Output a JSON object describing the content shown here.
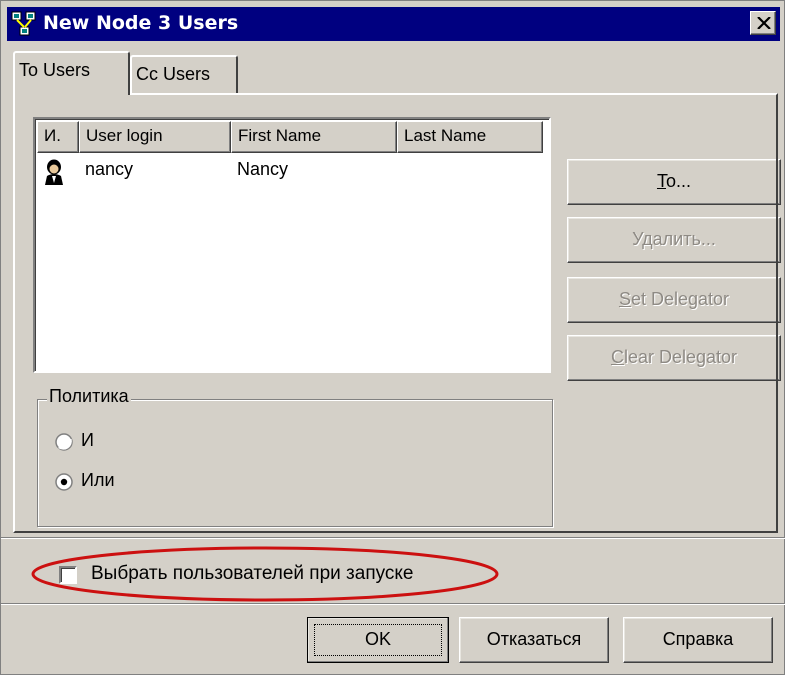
{
  "window": {
    "title": "New Node 3 Users",
    "icon": "network-nodes-icon",
    "close_icon": "close-icon"
  },
  "tabs": [
    {
      "label": "To Users",
      "active": true
    },
    {
      "label": "Cc Users",
      "active": false
    }
  ],
  "user_list": {
    "columns": [
      "И.",
      "User login",
      "First Name",
      "Last Name"
    ],
    "rows": [
      {
        "icon": "user-icon",
        "login": "nancy",
        "first_name": "Nancy",
        "last_name": ""
      }
    ]
  },
  "side_buttons": {
    "to": {
      "mnemonic": "T",
      "rest": "o...",
      "enabled": true
    },
    "delete": {
      "label": "Удалить...",
      "enabled": false
    },
    "set_delegator": {
      "mnemonic": "S",
      "rest": "et Delegator",
      "enabled": false
    },
    "clear_delegator": {
      "mnemonic": "C",
      "rest": "lear Delegator",
      "enabled": false
    }
  },
  "policy": {
    "title": "Политика",
    "options": [
      {
        "label": "И",
        "selected": false
      },
      {
        "label": "Или",
        "selected": true
      }
    ]
  },
  "select_on_start": {
    "label": "Выбрать пользователей при запуске",
    "checked": false,
    "highlight_color": "#cc1010"
  },
  "footer": {
    "ok": "OK",
    "cancel": "Отказаться",
    "help": "Справка"
  },
  "colors": {
    "titlebar": "#000080",
    "face": "#d4d0c8"
  }
}
